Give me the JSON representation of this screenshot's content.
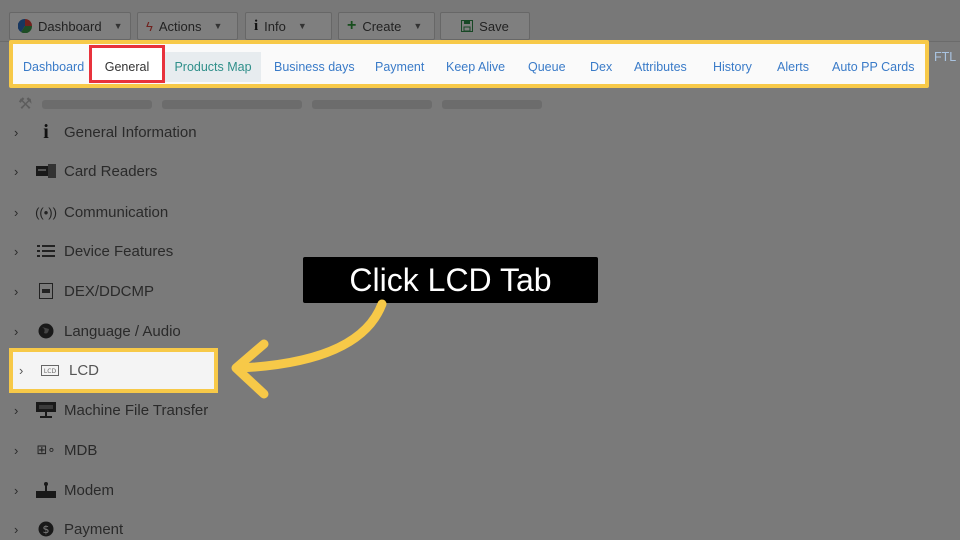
{
  "toolbar": {
    "buttons": [
      {
        "label": "Dashboard",
        "icon": "pie-chart-icon",
        "dropdown": true
      },
      {
        "label": "Actions",
        "icon": "bolt-icon",
        "dropdown": true
      },
      {
        "label": "Info",
        "icon": "info-icon",
        "dropdown": true
      },
      {
        "label": "Create",
        "icon": "plus-icon",
        "dropdown": true
      },
      {
        "label": "Save",
        "icon": "floppy-icon",
        "dropdown": false
      }
    ]
  },
  "tabs": [
    "Dashboard",
    "General",
    "Products Map",
    "Business days",
    "Payment",
    "Keep Alive",
    "Queue",
    "Dex",
    "Attributes",
    "History",
    "Alerts",
    "Auto PP Cards",
    "FTL"
  ],
  "active_tab": "General",
  "tree": [
    {
      "label": "General Information",
      "icon": "info-icon"
    },
    {
      "label": "Card Readers",
      "icon": "card-reader-icon"
    },
    {
      "label": "Communication",
      "icon": "antenna-icon"
    },
    {
      "label": "Device Features",
      "icon": "list-icon"
    },
    {
      "label": "DEX/DDCMP",
      "icon": "dex-icon"
    },
    {
      "label": "Language / Audio",
      "icon": "globe-icon"
    },
    {
      "label": "LCD",
      "icon": "lcd-icon"
    },
    {
      "label": "Machine File Transfer",
      "icon": "ftp-icon"
    },
    {
      "label": "MDB",
      "icon": "network-icon"
    },
    {
      "label": "Modem",
      "icon": "modem-icon"
    },
    {
      "label": "Payment",
      "icon": "dollar-icon"
    }
  ],
  "callout": {
    "text": "Click LCD Tab"
  },
  "colors": {
    "highlight": "#f7c948",
    "active_tab_border": "#e8323c",
    "tab_link": "#3a7bc8"
  }
}
